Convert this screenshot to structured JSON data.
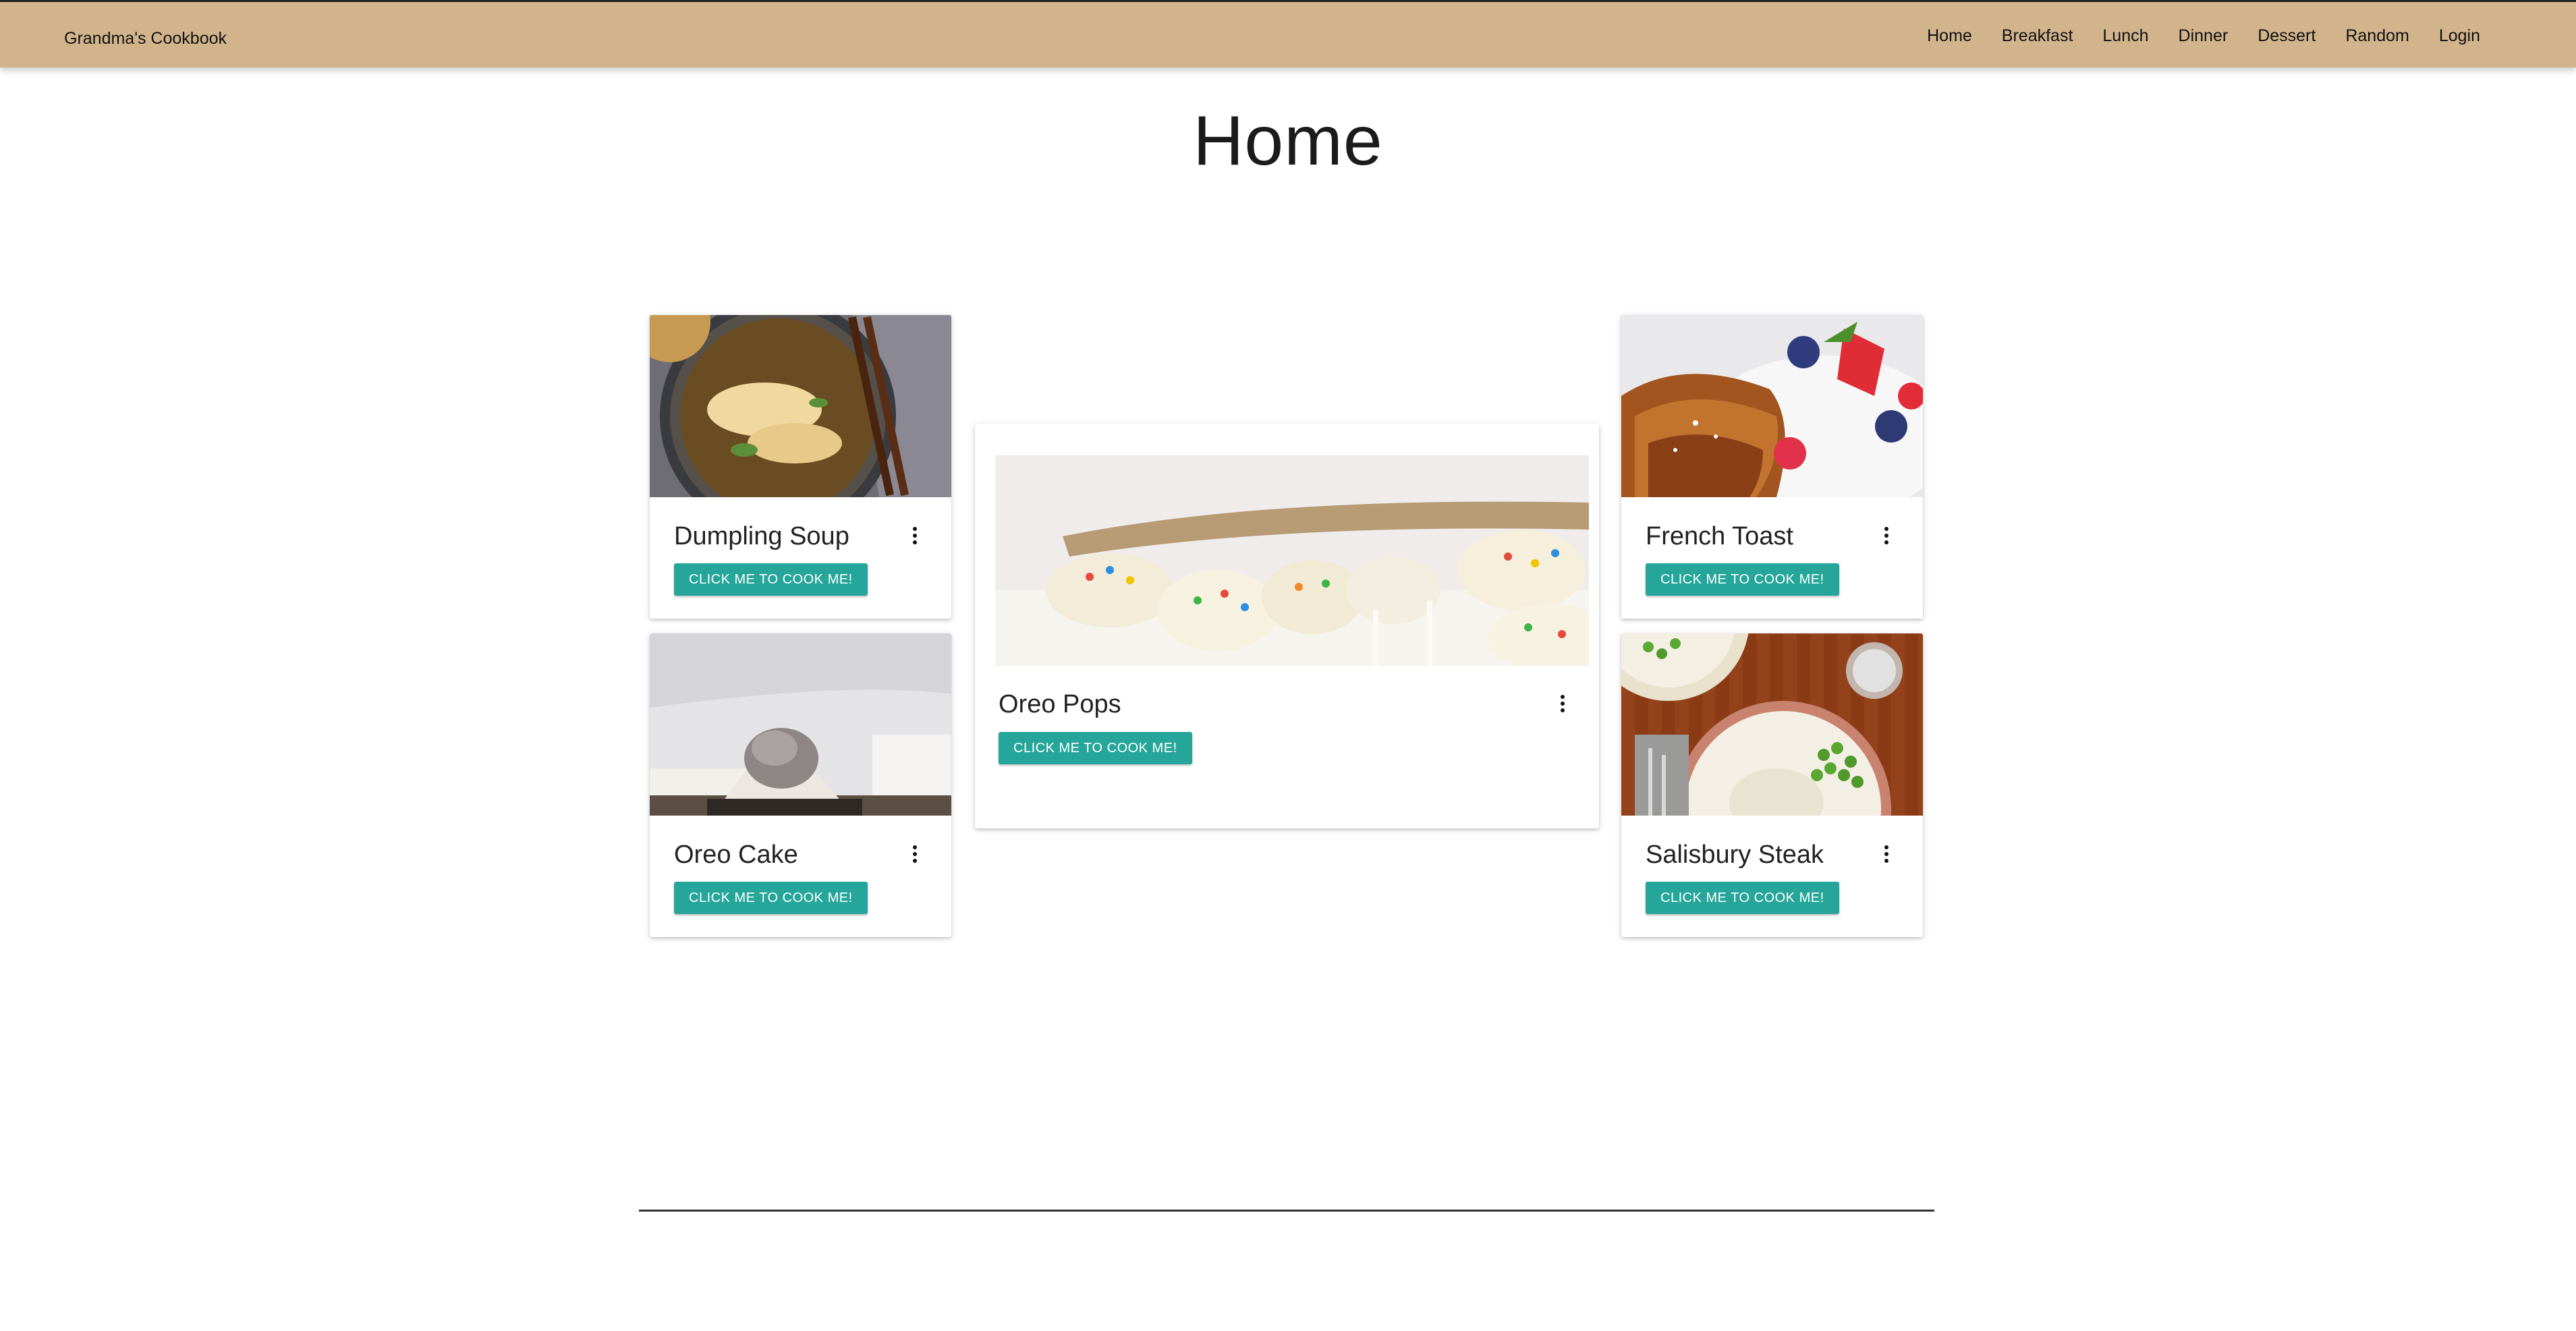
{
  "navbar": {
    "brand": "Grandma's Cookbook",
    "links": [
      "Home",
      "Breakfast",
      "Lunch",
      "Dinner",
      "Dessert",
      "Random",
      "Login"
    ]
  },
  "page": {
    "title": "Home"
  },
  "cards": [
    {
      "title": "Dumpling Soup",
      "button": "CLICK ME TO COOK ME!"
    },
    {
      "title": "Oreo Cake",
      "button": "CLICK ME TO COOK ME!"
    },
    {
      "title": "Oreo Pops",
      "button": "CLICK ME TO COOK ME!"
    },
    {
      "title": "French Toast",
      "button": "CLICK ME TO COOK ME!"
    },
    {
      "title": "Salisbury Steak",
      "button": "CLICK ME TO COOK ME!"
    }
  ],
  "colors": {
    "navbar_bg": "#d2b48c",
    "button_bg": "#26a69a"
  },
  "icons": {
    "card_menu": "more-vert-icon"
  }
}
